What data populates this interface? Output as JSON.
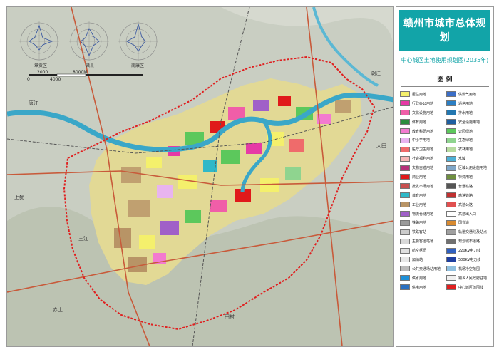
{
  "header": {
    "title": "赣州市城市总体规划",
    "subtitle": "（2017~2035年）",
    "map_title": "中心城区土地使用规划图(2035年)",
    "legend_title": "图 例"
  },
  "wind_roses": [
    "章贡区",
    "赣县",
    "南康区"
  ],
  "scale_bar": {
    "labels": [
      "0",
      "2000",
      "4000",
      "8000M"
    ]
  },
  "place_names": [
    "唐江",
    "三江",
    "大田",
    "上犹",
    "赤土",
    "湖江",
    "田村"
  ],
  "legend": {
    "col1": [
      {
        "label": "居住用地",
        "color": "#f4f06c"
      },
      {
        "label": "行政办公用地",
        "color": "#e63aa6"
      },
      {
        "label": "文化设施用地",
        "color": "#f05ea8"
      },
      {
        "label": "体育用地",
        "color": "#2b8d3d"
      },
      {
        "label": "教育科研用地",
        "color": "#f37ad0"
      },
      {
        "label": "中小学用地",
        "color": "#e8b4ef"
      },
      {
        "label": "医疗卫生用地",
        "color": "#ef6b6b"
      },
      {
        "label": "社会福利用地",
        "color": "#f7b7b7"
      },
      {
        "label": "文物古迹用地",
        "color": "#b6307a"
      },
      {
        "label": "商业用地",
        "color": "#e01a1a"
      },
      {
        "label": "批发市场用地",
        "color": "#c85050"
      },
      {
        "label": "体育用地",
        "color": "#2fb8c8"
      },
      {
        "label": "工业用地",
        "color": "#b89466"
      },
      {
        "label": "物流仓储用地",
        "color": "#a060c8"
      },
      {
        "label": "铁路用地",
        "color": "#9a9a9a"
      },
      {
        "label": "铁路客站",
        "color": "#cccccc"
      },
      {
        "label": "主要客运站场",
        "color": "#d8d8d8"
      },
      {
        "label": "航空枢纽",
        "color": "#e0e0e0"
      },
      {
        "label": "加油站",
        "color": "#e8e8e8"
      },
      {
        "label": "公共交通场站用地",
        "color": "#bbbbbb"
      },
      {
        "label": "供水用地",
        "color": "#1e90d8"
      },
      {
        "label": "供电用地",
        "color": "#2a6fbf"
      }
    ],
    "col2": [
      {
        "label": "供燃气用地",
        "color": "#3b6ec7"
      },
      {
        "label": "通信用地",
        "color": "#2b7fc4"
      },
      {
        "label": "排水用地",
        "color": "#2477b0"
      },
      {
        "label": "安全设施用地",
        "color": "#1f5fa0"
      },
      {
        "label": "公园绿地",
        "color": "#5cc85c"
      },
      {
        "label": "生态绿地",
        "color": "#8fd48f"
      },
      {
        "label": "农林用地",
        "color": "#b7dba0"
      },
      {
        "label": "水域",
        "color": "#4db0d6"
      },
      {
        "label": "区域公用设施用地",
        "color": "#7fa6c8"
      },
      {
        "label": "特殊用地",
        "color": "#6f8f3f"
      },
      {
        "label": "普通铁路",
        "color": "#555555"
      },
      {
        "label": "高速铁路",
        "color": "#c03030"
      },
      {
        "label": "高速公路",
        "color": "#e05050"
      },
      {
        "label": "高速出入口",
        "color": "#ffffff"
      },
      {
        "label": "国省道",
        "color": "#d88a30"
      },
      {
        "label": "轨道交通线及站点",
        "color": "#a0a0a0"
      },
      {
        "label": "规划城市道路",
        "color": "#707070"
      },
      {
        "label": "220KV电力线",
        "color": "#3060c0"
      },
      {
        "label": "500KV电力线",
        "color": "#2040a0"
      },
      {
        "label": "机场净空范围",
        "color": "#90c0e0"
      },
      {
        "label": "镇乡人民政府驻地",
        "color": "#f0f0f0"
      },
      {
        "label": "中心城区范围线",
        "color": "#e02020"
      }
    ]
  }
}
